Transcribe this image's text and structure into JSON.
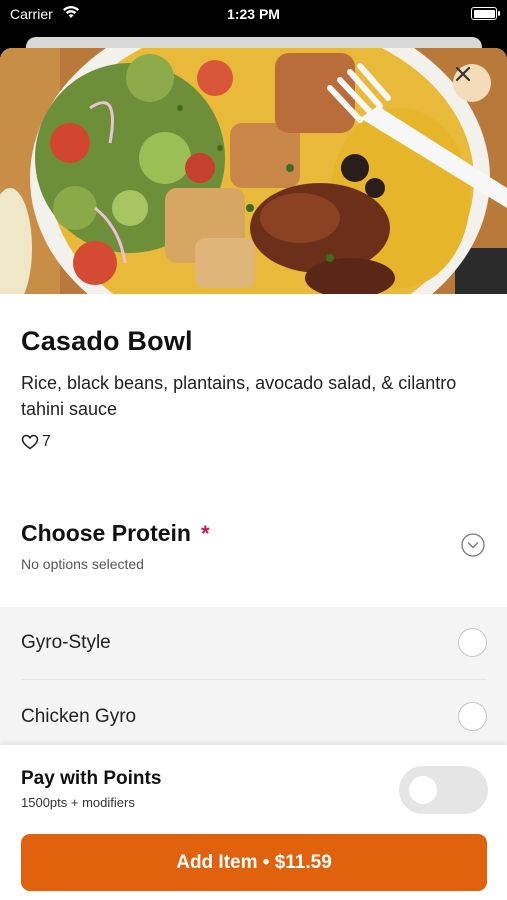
{
  "status_bar": {
    "carrier": "Carrier",
    "time": "1:23 PM",
    "icons": [
      "wifi-icon",
      "battery-icon"
    ]
  },
  "hero": {
    "image": "food-photo-casado-bowl",
    "close_icon": "close-icon"
  },
  "item": {
    "title": "Casado Bowl",
    "description": "Rice, black beans, plantains, avocado salad, & cilantro tahini sauce",
    "likes": "7",
    "like_icon": "heart-outline-icon"
  },
  "protein": {
    "title": "Choose Protein",
    "required_mark": "*",
    "subtitle": "No options selected",
    "chevron_icon": "chevron-down-icon",
    "options": [
      {
        "label": "Gyro-Style",
        "selected": false
      },
      {
        "label": "Chicken Gyro",
        "selected": false
      }
    ]
  },
  "footer": {
    "points_label": "Pay with Points",
    "points_sub": "1500pts + modifiers",
    "points_toggle_on": false,
    "add_button_label": "Add Item • $11.59"
  },
  "colors": {
    "accent": "#e0620d",
    "required": "#c2185b",
    "close_button_bg": "#f4dcb8"
  }
}
